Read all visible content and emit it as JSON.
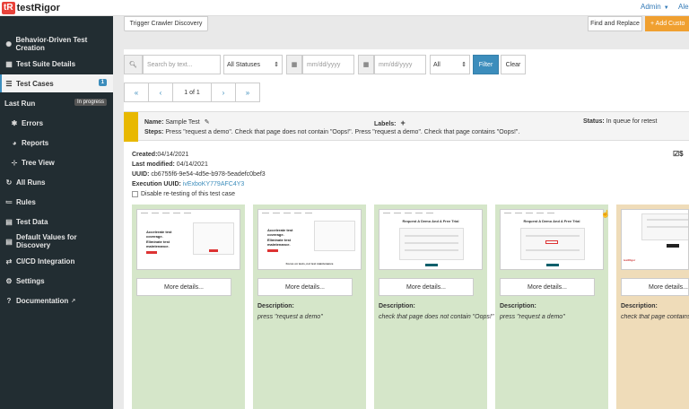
{
  "topbar": {
    "logo_mark": "tR",
    "logo_text": "testRigor",
    "admin_label": "Admin",
    "user_abbr": "Ale"
  },
  "sidebar": {
    "items": [
      {
        "label": "Behavior-Driven Test Creation",
        "icon": "brain-icon"
      },
      {
        "label": "Test Suite Details",
        "icon": "grid-icon"
      },
      {
        "label": "Test Cases",
        "icon": "list-icon",
        "badge": "1"
      },
      {
        "label": "Last Run",
        "icon": "",
        "status": "In progress"
      },
      {
        "label": "Errors",
        "icon": "bug-icon"
      },
      {
        "label": "Reports",
        "icon": "pie-chart-icon"
      },
      {
        "label": "Tree View",
        "icon": "tree-icon"
      },
      {
        "label": "All Runs",
        "icon": "history-icon"
      },
      {
        "label": "Rules",
        "icon": "rules-icon"
      },
      {
        "label": "Test Data",
        "icon": "table-icon"
      },
      {
        "label": "Default Values for Discovery",
        "icon": "table-icon"
      },
      {
        "label": "CI/CD Integration",
        "icon": "cicd-icon"
      },
      {
        "label": "Settings",
        "icon": "gears-icon"
      },
      {
        "label": "Documentation",
        "icon": "question-icon"
      }
    ]
  },
  "toolbar": {
    "trigger_label": "Trigger Crawler Discovery",
    "find_replace_label": "Find and Replace",
    "add_custom_label": "+ Add Custo"
  },
  "filters": {
    "search_placeholder": "Search by text...",
    "status_value": "All Statuses",
    "date_from_placeholder": "mm/dd/yyyy",
    "date_to_placeholder": "mm/dd/yyyy",
    "type_value": "All",
    "filter_label": "Filter",
    "clear_label": "Clear"
  },
  "pagination": {
    "first": "«",
    "prev": "‹",
    "info": "1 of 1",
    "next": "›",
    "last": "»"
  },
  "test_case": {
    "name_label": "Name:",
    "name_value": "Sample Test",
    "labels_label": "Labels:",
    "status_label": "Status:",
    "status_value": "In queue for retest",
    "steps_label": "Steps:",
    "steps_value": "Press \"request a demo\". Check that page does not contain \"Oops!\". Press \"request a demo\". Check that page contains \"Oops!\".",
    "created_label": "Created:",
    "created_value": "04/14/2021",
    "modified_label": "Last modified:",
    "modified_value": "04/14/2021",
    "uuid_label": "UUID:",
    "uuid_value": "cb6755f6-9e54-4d5e-b978-5eadefc0bef3",
    "exec_uuid_label": "Execution UUID:",
    "exec_uuid_value": "ivExboKY779AFC4Y3",
    "disable_retest_label": "Disable re-testing of this test case"
  },
  "screenshots": [
    {
      "more_label": "More details...",
      "desc_label": "",
      "desc_text": "",
      "status": "pass"
    },
    {
      "more_label": "More details...",
      "desc_label": "Description:",
      "desc_text": "press \"request a demo\"",
      "status": "pass"
    },
    {
      "more_label": "More details...",
      "desc_label": "Description:",
      "desc_text": "check that page does not contain \"Oops!\"",
      "status": "pass"
    },
    {
      "more_label": "More details...",
      "desc_label": "Description:",
      "desc_text": "press \"request a demo\"",
      "status": "pass"
    },
    {
      "more_label": "More details...",
      "desc_label": "Description:",
      "desc_text": "check that page contains \"Oops!\"",
      "status": "warning"
    }
  ],
  "thumb_text": {
    "hero_1": "Accelerate test coverage.",
    "hero_2": "Eliminate test maintenance.",
    "demo_title": "Request A Demo And A Free Trial",
    "caption": "Focus on tests, not test maintenance"
  },
  "colors": {
    "sidebar_bg": "#222d32",
    "accent": "#3c8dbc",
    "stripe": "#e8b800",
    "card_pass": "#d5e6c9",
    "card_warn": "#efdcb9"
  }
}
